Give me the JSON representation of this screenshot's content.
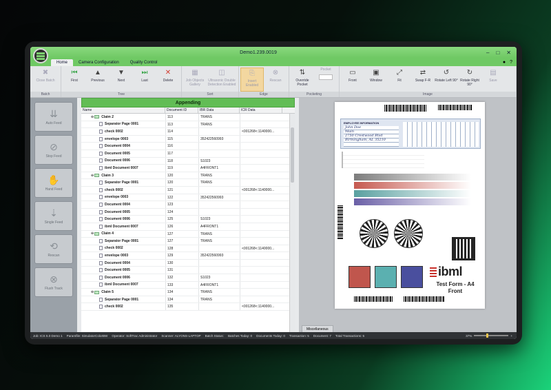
{
  "window": {
    "title": "Demo1.239.0019",
    "minimize": "–",
    "maximize": "□",
    "close": "✕"
  },
  "menu": {
    "tabs": [
      {
        "label": "Home",
        "active": true
      },
      {
        "label": "Camera Configuration",
        "active": false
      },
      {
        "label": "Quality Control",
        "active": false
      }
    ]
  },
  "ribbon": {
    "groups": [
      {
        "label": "Batch",
        "buttons": [
          {
            "label": "Close Batch",
            "icon": "close-batch-icon"
          }
        ]
      },
      {
        "label": "Tree",
        "buttons": [
          {
            "label": "First",
            "icon": "first-icon"
          },
          {
            "label": "Previous",
            "icon": "previous-icon"
          },
          {
            "label": "Next",
            "icon": "next-icon"
          },
          {
            "label": "Last",
            "icon": "last-icon"
          },
          {
            "label": "Delete",
            "icon": "delete-icon"
          }
        ]
      },
      {
        "label": "Sort",
        "buttons": [
          {
            "label": "Job Objects Gallery",
            "icon": "gallery-icon"
          },
          {
            "label": "Ultrasonic Double Detection Enabled",
            "icon": "ultrasonic-icon"
          }
        ]
      },
      {
        "label": "Edge",
        "buttons": [
          {
            "label": "Insert Enabled",
            "icon": "insert-icon"
          },
          {
            "label": "Rescan",
            "icon": "rescan-icon"
          }
        ]
      },
      {
        "label": "Pocketing",
        "buttons": [
          {
            "label": "Override Pocket",
            "icon": "override-pocket-icon"
          },
          {
            "label": "Pocket",
            "icon": "pocket-icon"
          }
        ]
      },
      {
        "label": "Image",
        "buttons": [
          {
            "label": "Front",
            "icon": "front-icon"
          },
          {
            "label": "Window",
            "icon": "window-icon"
          },
          {
            "label": "Fit",
            "icon": "fit-icon"
          },
          {
            "label": "Swap F-R",
            "icon": "swap-icon"
          },
          {
            "label": "Rotate Left 90°",
            "icon": "rotate-left-icon"
          },
          {
            "label": "Rotate Right 90°",
            "icon": "rotate-right-icon"
          },
          {
            "label": "Save",
            "icon": "save-icon"
          }
        ]
      }
    ]
  },
  "left_panel": {
    "buttons": [
      "Auto Feed",
      "Stop Feed",
      "Hand Feed",
      "Single Feed",
      "Rescan",
      "Flush Track"
    ]
  },
  "tree": {
    "header": "Appending",
    "columns": [
      "Name",
      "Document ID",
      "IBR Data",
      "ICR Data"
    ],
    "rows": [
      {
        "name": "Claim 2",
        "id": "113",
        "ibr": "TRANS",
        "icr": "",
        "type": "claim"
      },
      {
        "name": "Separator Page 0001",
        "id": "113",
        "ibr": "TRANS",
        "icr": "",
        "type": "doc"
      },
      {
        "name": "check 0002",
        "id": "114",
        "ibr": "",
        "icr": "<001268<:1140000...",
        "type": "doc"
      },
      {
        "name": "envelope 0003",
        "id": "115",
        "ibr": "352422560993",
        "icr": "",
        "type": "doc"
      },
      {
        "name": "Document 0004",
        "id": "116",
        "ibr": "",
        "icr": "",
        "type": "doc"
      },
      {
        "name": "Document 0005",
        "id": "117",
        "ibr": "",
        "icr": "",
        "type": "doc"
      },
      {
        "name": "Document 0006",
        "id": "118",
        "ibr": "S1023",
        "icr": "",
        "type": "doc"
      },
      {
        "name": "ibml Document 0007",
        "id": "119",
        "ibr": "A4FRONT1",
        "icr": "",
        "type": "doc"
      },
      {
        "name": "Claim 3",
        "id": "120",
        "ibr": "TRANS",
        "icr": "",
        "type": "claim"
      },
      {
        "name": "Separator Page 0001",
        "id": "120",
        "ibr": "TRANS",
        "icr": "",
        "type": "doc"
      },
      {
        "name": "check 0002",
        "id": "121",
        "ibr": "",
        "icr": "<001268<:1140000...",
        "type": "doc"
      },
      {
        "name": "envelope 0003",
        "id": "122",
        "ibr": "352422560993",
        "icr": "",
        "type": "doc"
      },
      {
        "name": "Document 0004",
        "id": "123",
        "ibr": "",
        "icr": "",
        "type": "doc"
      },
      {
        "name": "Document 0005",
        "id": "124",
        "ibr": "",
        "icr": "",
        "type": "doc"
      },
      {
        "name": "Document 0006",
        "id": "125",
        "ibr": "S1023",
        "icr": "",
        "type": "doc"
      },
      {
        "name": "ibml Document 0007",
        "id": "126",
        "ibr": "A4FRONT1",
        "icr": "",
        "type": "doc"
      },
      {
        "name": "Claim 4",
        "id": "127",
        "ibr": "TRANS",
        "icr": "",
        "type": "claim"
      },
      {
        "name": "Separator Page 0001",
        "id": "127",
        "ibr": "TRANS",
        "icr": "",
        "type": "doc"
      },
      {
        "name": "check 0002",
        "id": "128",
        "ibr": "",
        "icr": "<001268<:1140000...",
        "type": "doc"
      },
      {
        "name": "envelope 0003",
        "id": "129",
        "ibr": "352422560993",
        "icr": "",
        "type": "doc"
      },
      {
        "name": "Document 0004",
        "id": "130",
        "ibr": "",
        "icr": "",
        "type": "doc"
      },
      {
        "name": "Document 0005",
        "id": "131",
        "ibr": "",
        "icr": "",
        "type": "doc"
      },
      {
        "name": "Document 0006",
        "id": "132",
        "ibr": "S1023",
        "icr": "",
        "type": "doc"
      },
      {
        "name": "ibml Document 0007",
        "id": "133",
        "ibr": "A4FRONT1",
        "icr": "",
        "type": "doc"
      },
      {
        "name": "Claim 5",
        "id": "134",
        "ibr": "TRANS",
        "icr": "",
        "type": "claim"
      },
      {
        "name": "Separator Page 0001",
        "id": "134",
        "ibr": "TRANS",
        "icr": "",
        "type": "doc"
      },
      {
        "name": "check 0002",
        "id": "135",
        "ibr": "",
        "icr": "<001268<:1140000...",
        "type": "doc"
      }
    ]
  },
  "preview": {
    "tab": "Miscellaneous",
    "form": {
      "section_title": "EMPLOYEE INFORMATION",
      "handwriting": [
        "John Doe",
        "Main",
        "2750 Crestwood Blvd",
        "Birmingham, AL 35210"
      ],
      "logo": "ibml",
      "caption_line1": "Test Form - A4",
      "caption_line2": "Front",
      "bar_colors": [
        "#7d7d7d",
        "#c65a50",
        "#5aa0a0",
        "#6a5fa6"
      ],
      "swatch_colors": [
        "#c0564d",
        "#5bb0b0",
        "#4a4f9e"
      ]
    }
  },
  "status": {
    "items": [
      "Job: ICS 5.0 Demo 1",
      "Paramfile: SimulatorColorBW",
      "Operator: SoftTrac Administrator",
      "Scanner: ALYONS-LAPTOP",
      "Batch Status:",
      "Batches Today: 0",
      "Documents Today: 0",
      "Transaction: 5",
      "Document: 7",
      "Total Transactions: 5"
    ],
    "zoom": "37%"
  }
}
